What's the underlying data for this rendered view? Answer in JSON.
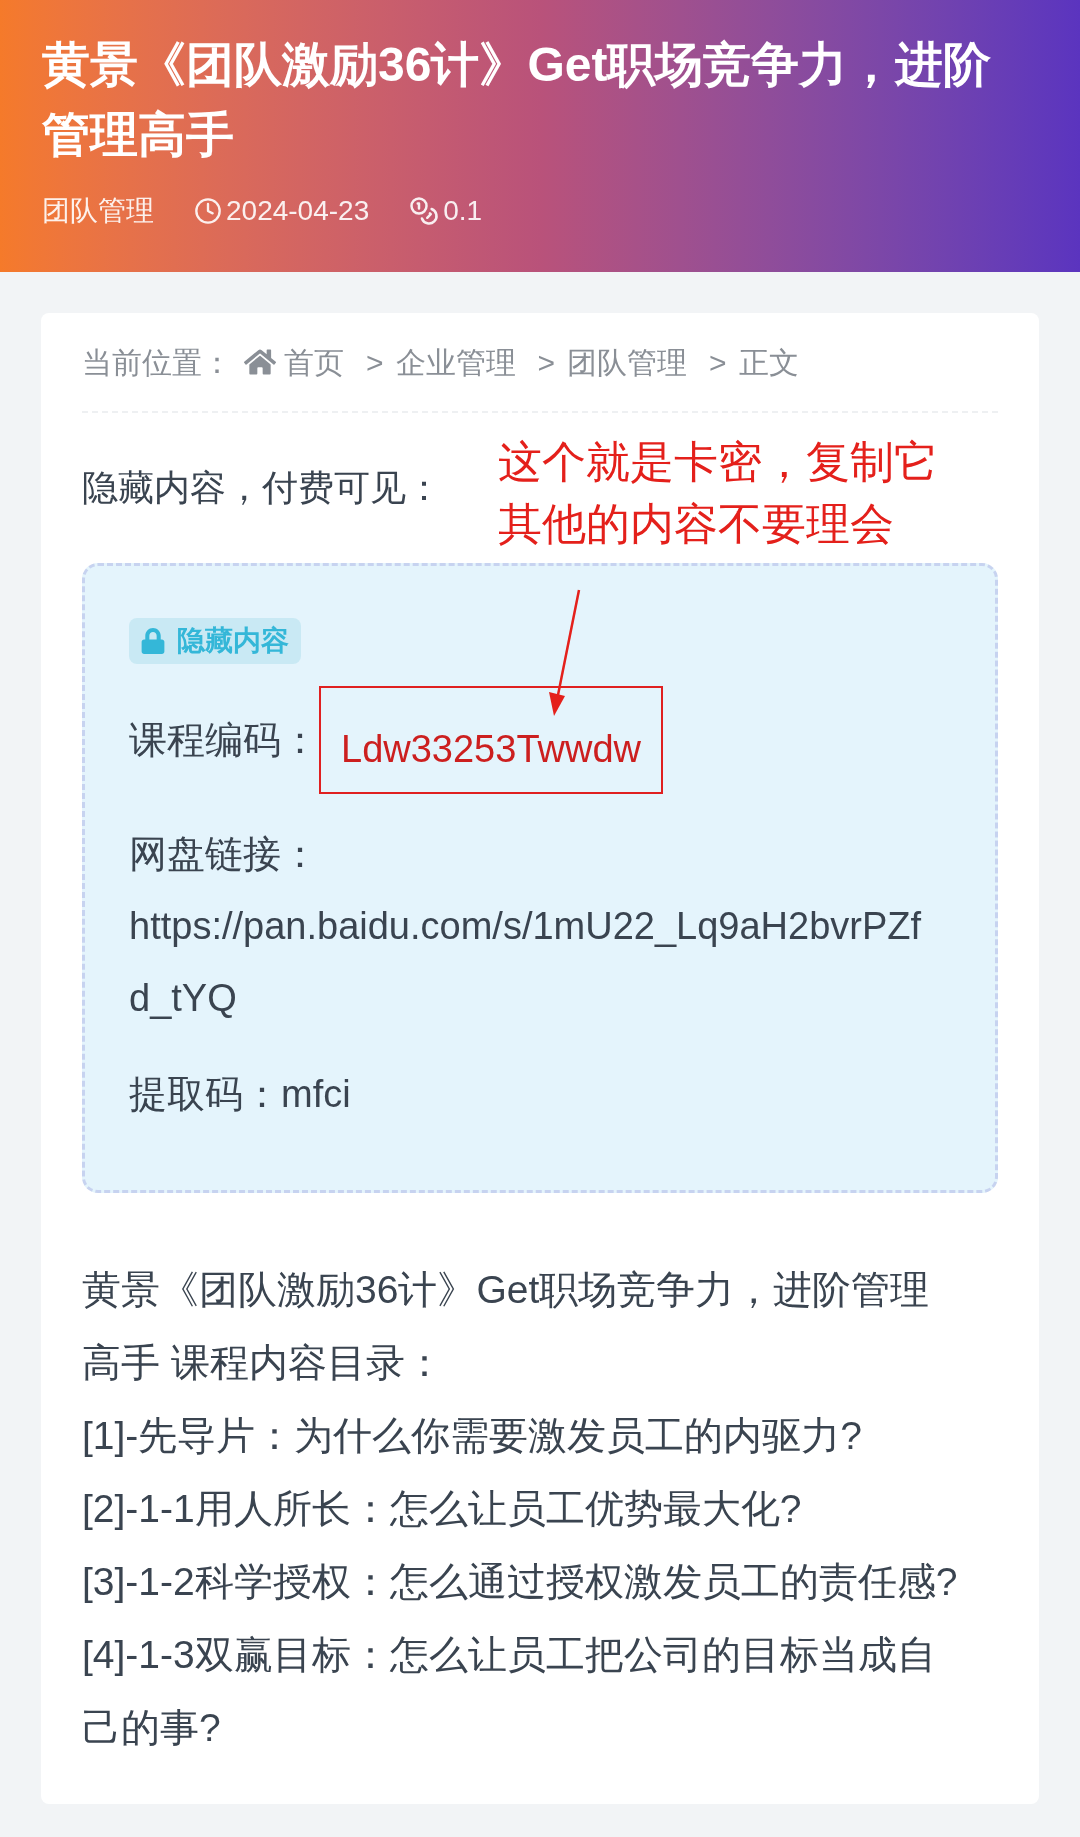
{
  "header": {
    "title": "黄景《团队激励36计》Get职场竞争力，进阶管理高手",
    "category": "团队管理",
    "date": "2024-04-23",
    "price": "0.1"
  },
  "breadcrumb": {
    "label": "当前位置：",
    "items": [
      "首页",
      "企业管理",
      "团队管理",
      "正文"
    ],
    "separator": ">"
  },
  "hidden_notice": "隐藏内容，付费可见：",
  "annotation": {
    "lines": [
      "这个就是卡密，复制它",
      "其他的内容不要理会"
    ]
  },
  "hidden_box": {
    "badge": "隐藏内容",
    "fields": [
      {
        "kind": "highlighted",
        "label": "课程编码：",
        "value": "Ldw33253Twwdw"
      },
      {
        "kind": "block",
        "label": "网盘链接：",
        "value": "https://pan.baidu.com/s/1mU22_Lq9aH2bvrPZfd_tYQ"
      },
      {
        "kind": "inline",
        "label": "提取码：",
        "value": "mfci"
      }
    ]
  },
  "content": [
    "黄景《团队激励36计》Get职场竞争力，进阶管理高手 课程内容目录：",
    "[1]-先导片：为什么你需要激发员工的内驱力?",
    "[2]-1-1用人所长：怎么让员工优势最大化?",
    "[3]-1-2科学授权：怎么通过授权激发员工的责任感?",
    "[4]-1-3双赢目标：怎么让员工把公司的目标当成自己的事?"
  ]
}
